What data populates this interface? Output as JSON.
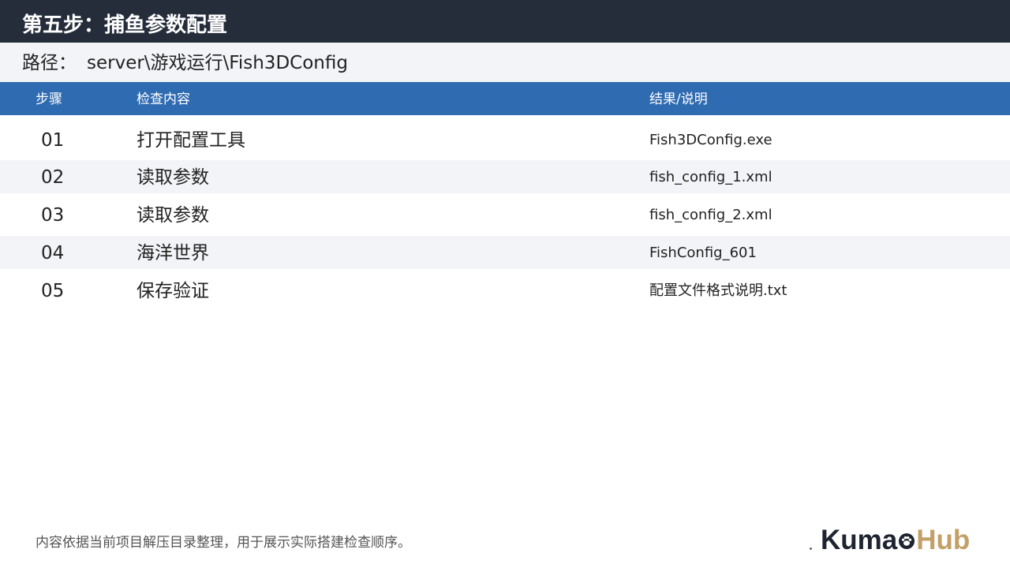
{
  "title": "第五步：捕鱼参数配置",
  "path": {
    "label": "路径：",
    "value": "server\\游戏运行\\Fish3DConfig"
  },
  "table": {
    "headers": {
      "step": "步骤",
      "content": "检查内容",
      "result": "结果/说明"
    },
    "rows": [
      {
        "num": "01",
        "content": "打开配置工具",
        "result": "Fish3DConfig.exe"
      },
      {
        "num": "02",
        "content": "读取参数",
        "result": "fish_config_1.xml"
      },
      {
        "num": "03",
        "content": "读取参数",
        "result": "fish_config_2.xml"
      },
      {
        "num": "04",
        "content": "海洋世界",
        "result": "FishConfig_601"
      },
      {
        "num": "05",
        "content": "保存验证",
        "result": "配置文件格式说明.txt"
      }
    ]
  },
  "footer": {
    "note": "内容依据当前项目解压目录整理，用于展示实际搭建检查顺序。"
  },
  "logo": {
    "part1": "Kuma",
    "part2": "Hub",
    "paw_icon": "paw-icon"
  },
  "colors": {
    "title_bar": "#252d3b",
    "header_blue": "#2f6bb1",
    "row_alt": "#f2f4f7",
    "logo_gold": "#c2a067"
  }
}
